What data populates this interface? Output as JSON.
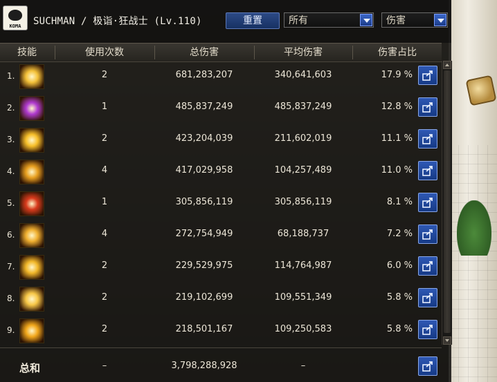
{
  "header": {
    "player": "SUCHMAN / 极诣·狂战士 (Lv.110)",
    "reset_label": "重置",
    "filter_select": "所有",
    "metric_select": "伤害",
    "avatar_tag": "KOMA"
  },
  "columns": [
    "技能",
    "使用次数",
    "总伤害",
    "平均伤害",
    "伤害占比"
  ],
  "rows": [
    {
      "rank": "1.",
      "uses": "2",
      "total": "681,283,207",
      "avg": "340,641,603",
      "pct": "17.9 %",
      "icon_color": "#f4c23a"
    },
    {
      "rank": "2.",
      "uses": "1",
      "total": "485,837,249",
      "avg": "485,837,249",
      "pct": "12.8 %",
      "icon_color": "#b03ad0"
    },
    {
      "rank": "3.",
      "uses": "2",
      "total": "423,204,039",
      "avg": "211,602,019",
      "pct": "11.1 %",
      "icon_color": "#f7c02a"
    },
    {
      "rank": "4.",
      "uses": "4",
      "total": "417,029,958",
      "avg": "104,257,489",
      "pct": "11.0 %",
      "icon_color": "#e8a020"
    },
    {
      "rank": "5.",
      "uses": "1",
      "total": "305,856,119",
      "avg": "305,856,119",
      "pct": "8.1 %",
      "icon_color": "#d83a1c"
    },
    {
      "rank": "6.",
      "uses": "4",
      "total": "272,754,949",
      "avg": "68,188,737",
      "pct": "7.2 %",
      "icon_color": "#f0b030"
    },
    {
      "rank": "7.",
      "uses": "2",
      "total": "229,529,975",
      "avg": "114,764,987",
      "pct": "6.0 %",
      "icon_color": "#f2b82a"
    },
    {
      "rank": "8.",
      "uses": "2",
      "total": "219,102,699",
      "avg": "109,551,349",
      "pct": "5.8 %",
      "icon_color": "#f7c848"
    },
    {
      "rank": "9.",
      "uses": "2",
      "total": "218,501,167",
      "avg": "109,250,583",
      "pct": "5.8 %",
      "icon_color": "#f2a81c"
    }
  ],
  "total": {
    "label": "总和",
    "uses": "–",
    "total": "3,798,288,928",
    "avg": "–"
  }
}
